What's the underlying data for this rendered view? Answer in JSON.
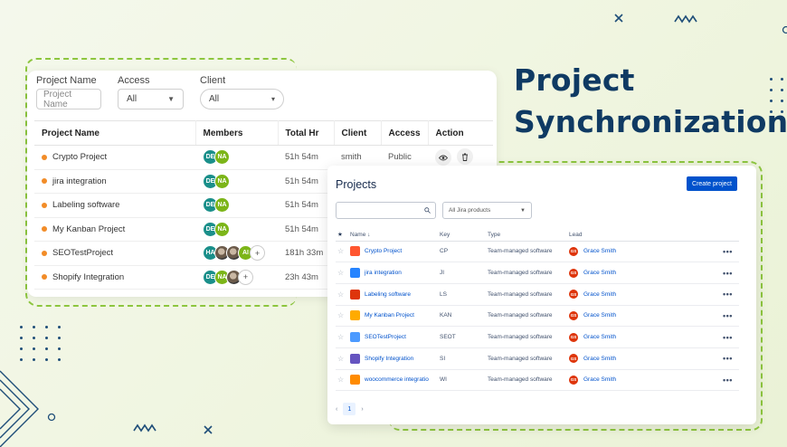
{
  "hero": {
    "title_line1": "Project",
    "title_line2": "Synchronization"
  },
  "filters": {
    "project_name": {
      "label": "Project Name",
      "placeholder": "Project Name"
    },
    "access": {
      "label": "Access",
      "value": "All"
    },
    "client": {
      "label": "Client",
      "value": "All"
    }
  },
  "left_table": {
    "headers": [
      "Project Name",
      "Members",
      "Total Hr",
      "Client",
      "Access",
      "Action"
    ],
    "rows": [
      {
        "name": "Crypto Project",
        "members": [
          "DE",
          "NA"
        ],
        "total_hr": "51h 54m",
        "client": "smith",
        "access": "Public"
      },
      {
        "name": "jira integration",
        "members": [
          "DE",
          "NA"
        ],
        "total_hr": "51h 54m"
      },
      {
        "name": "Labeling software",
        "members": [
          "DE",
          "NA"
        ],
        "total_hr": "51h 54m"
      },
      {
        "name": "My Kanban Project",
        "members": [
          "DE",
          "NA"
        ],
        "total_hr": "51h 54m"
      },
      {
        "name": "SEOTestProject",
        "members": [
          "HA",
          "",
          "",
          "AI",
          "+"
        ],
        "total_hr": "181h 33m"
      },
      {
        "name": "Shopify Integration",
        "members": [
          "DE",
          "NA",
          "",
          "+"
        ],
        "total_hr": "23h 43m"
      }
    ]
  },
  "right_panel": {
    "title": "Projects",
    "create_button": "Create project",
    "product_filter": "All Jira products",
    "headers": {
      "name": "Name",
      "key": "Key",
      "type": "Type",
      "lead": "Lead"
    },
    "rows": [
      {
        "name": "Crypto Project",
        "key": "CP",
        "type": "Team-managed software",
        "lead": "Grace Smith",
        "lead_initials": "GS",
        "icon_color": "#ff5630"
      },
      {
        "name": "jira integration",
        "key": "JI",
        "type": "Team-managed software",
        "lead": "Grace Smith",
        "lead_initials": "GS",
        "icon_color": "#2684ff"
      },
      {
        "name": "Labeling software",
        "key": "LS",
        "type": "Team-managed software",
        "lead": "Grace Smith",
        "lead_initials": "GS",
        "icon_color": "#de350b"
      },
      {
        "name": "My Kanban Project",
        "key": "KAN",
        "type": "Team-managed software",
        "lead": "Grace Smith",
        "lead_initials": "GS",
        "icon_color": "#ffab00"
      },
      {
        "name": "SEOTestProject",
        "key": "SEOT",
        "type": "Team-managed software",
        "lead": "Grace Smith",
        "lead_initials": "GS",
        "icon_color": "#4c9aff"
      },
      {
        "name": "Shopify Integration",
        "key": "SI",
        "type": "Team-managed software",
        "lead": "Grace Smith",
        "lead_initials": "GS",
        "icon_color": "#6554c0"
      },
      {
        "name": "woocommerce integratio",
        "key": "WI",
        "type": "Team-managed software",
        "lead": "Grace Smith",
        "lead_initials": "GS",
        "icon_color": "#ff8b00"
      }
    ],
    "pagination": {
      "current": "1"
    }
  },
  "colors": {
    "brand_navy": "#0f3a63",
    "accent_green": "#8dc63f",
    "jira_blue": "#0052cc",
    "dot_orange": "#f28c28"
  }
}
